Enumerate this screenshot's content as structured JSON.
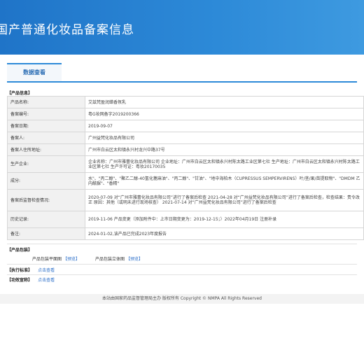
{
  "banner_title": "国产普通化妆品备案信息",
  "tab_label": "数据查看",
  "section_product": "【产品信息】",
  "rows": [
    {
      "label": "产品名称:",
      "value": "艾兹梵盈润蜡香氛乳"
    },
    {
      "label": "备案编号:",
      "value": "粤G妆网备字2019200366"
    },
    {
      "label": "备案日期:",
      "value": "2019-09-07"
    },
    {
      "label": "备案人:",
      "value": "广州益梵化妆品有限公司"
    },
    {
      "label": "备案人住所地址:",
      "value": "广州市白云区太和镇永兴村龙兴中路37号"
    },
    {
      "label": "生产企业:",
      "value": "企业名称：广州市雅蕾化妆品有限公司 企业地址：广州市白云区太和镇永兴村陈太路工业区第七社 生产地址：广州市白云区太和镇永兴村陈太路工业区第七社 生产许可证：粤妆20170035"
    },
    {
      "label": "成分:",
      "value": "水\"、\"丙二醇\"、\"聚乙二醇-40氢化蓖麻油\"、\"丙二醇\"、\"甘油\"、\"地中海柏木（CUPRESSUS SEMPERVIRENS）叶/茎/果/苗提取物\"、\"DMDM 乙内酰脲\"、\"香精\""
    },
    {
      "label": "备案后监督检查情况:",
      "value": "2020-07-09 对“广州市雅蕾化妆品有限公司”进行了备案后检查 2021-04-28 对“广州益梵化妆品有限公司”进行了备案后检查，检查结果：责令改正 原因：其他（或明未进行现场核查） 2021-07-14 对“广州益梵化妆品有限公司”进行了备案后检查"
    },
    {
      "label": "历史记录:",
      "value": "2019-11-06 产品变更（添加附件中：上市日期变更为：2019-12-15；）2022年04月19日 注册补录"
    },
    {
      "label": "备注:",
      "value": "2024-01-02,该产品已完成2023年度报告"
    }
  ],
  "section_package": "【产品包装】",
  "package": {
    "flat_label": "产品包装平面图",
    "solid_label": "产品包装立体图",
    "preview": "【预览】"
  },
  "standard_label": "【执行标准】",
  "function_label": "【功效宣称】",
  "click_view": "点击查看",
  "footer": "本站由国家药品监督管理局主办 版权所有 Copyright © NMPA All Rights Reserved"
}
